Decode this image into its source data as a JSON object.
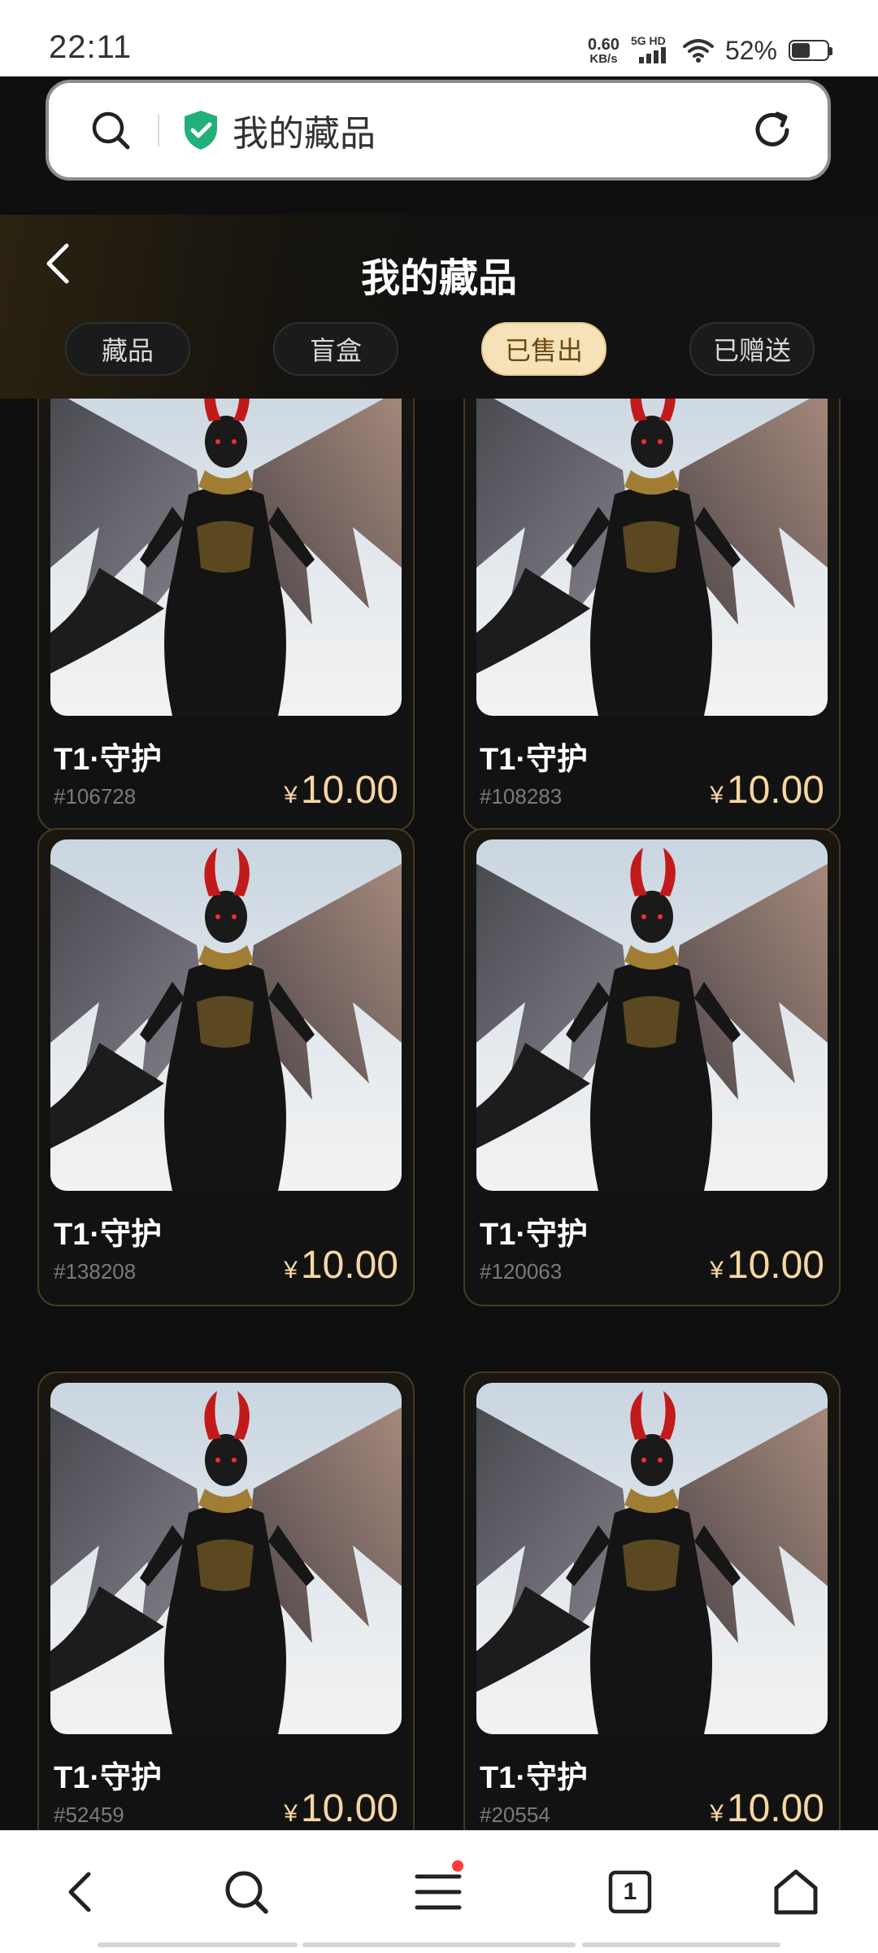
{
  "status_bar": {
    "time": "22:11",
    "net_speed_value": "0.60",
    "net_speed_unit": "KB/s",
    "signal_label": "5G HD",
    "battery_percent": "52%",
    "battery_level": 0.52
  },
  "address_bar": {
    "text": "我的藏品"
  },
  "header": {
    "title": "我的藏品"
  },
  "tabs": [
    {
      "label": "藏品",
      "active": false
    },
    {
      "label": "盲盒",
      "active": false
    },
    {
      "label": "已售出",
      "active": true
    },
    {
      "label": "已赠送",
      "active": false
    }
  ],
  "cards": [
    {
      "name": "T1·守护",
      "id": "#106728",
      "currency": "¥",
      "price": "10.00"
    },
    {
      "name": "T1·守护",
      "id": "#108283",
      "currency": "¥",
      "price": "10.00"
    },
    {
      "name": "T1·守护",
      "id": "#138208",
      "currency": "¥",
      "price": "10.00"
    },
    {
      "name": "T1·守护",
      "id": "#120063",
      "currency": "¥",
      "price": "10.00"
    },
    {
      "name": "T1·守护",
      "id": "#52459",
      "currency": "¥",
      "price": "10.00"
    },
    {
      "name": "T1·守护",
      "id": "#20554",
      "currency": "¥",
      "price": "10.00"
    }
  ],
  "bottom_nav": {
    "tab_count": "1",
    "icons": [
      "back-icon",
      "search-icon",
      "menu-icon",
      "tabs-icon",
      "home-icon"
    ]
  },
  "colors": {
    "accent_gold": "#f6d6a2",
    "active_tab_bg": "#f6e2b8",
    "shield_green": "#21b07a",
    "notification_dot": "#ff3b3b"
  }
}
